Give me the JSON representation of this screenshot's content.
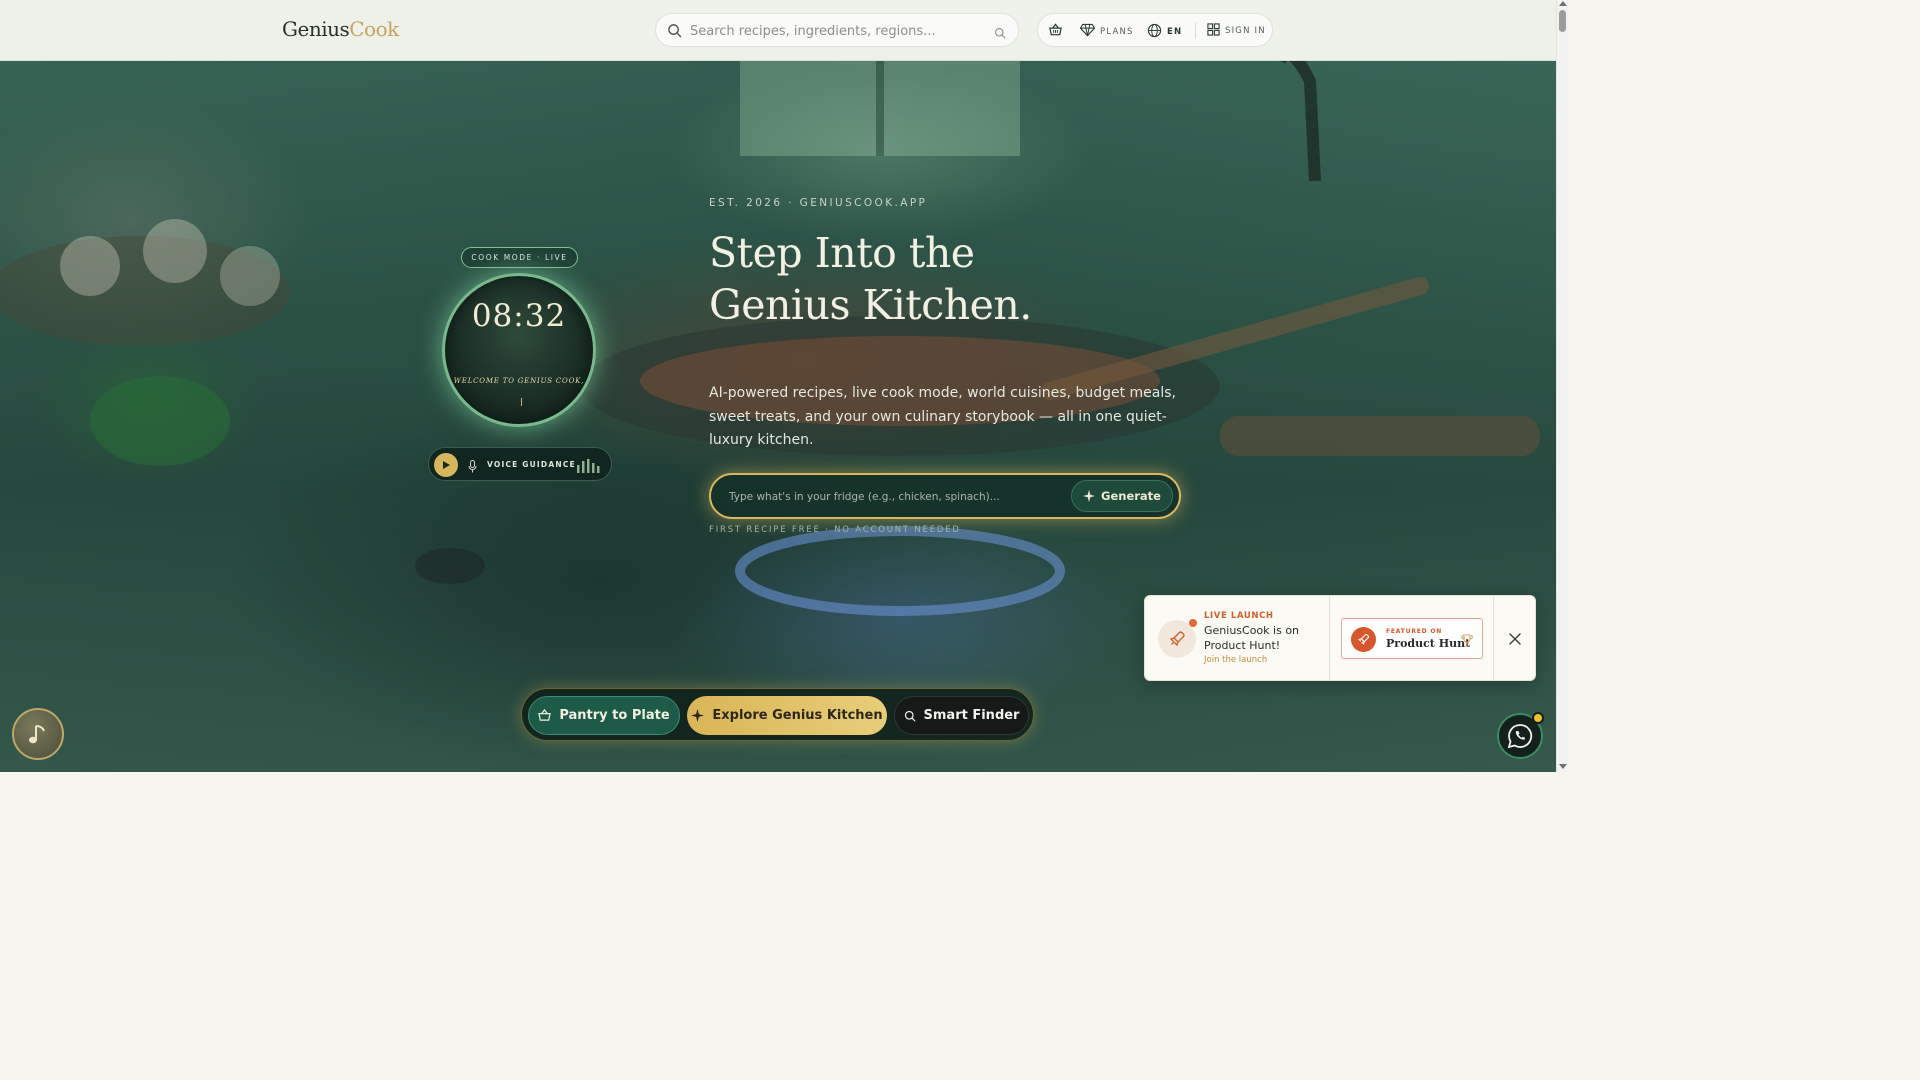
{
  "header": {
    "logo_main": "Genius",
    "logo_accent": "Cook",
    "search_placeholder": "Search recipes, ingredients, regions...",
    "nav": {
      "basket_icon": "basket-icon",
      "plans_label": "PLANS",
      "lang_label": "EN",
      "signin_label": "SIGN IN"
    }
  },
  "hero": {
    "eyebrow": "EST. 2026 · GENIUSCOOK.APP",
    "title_line1": "Step Into the",
    "title_line2": "Genius Kitchen.",
    "subtitle": "AI-powered recipes, live cook mode, world cuisines, budget meals, sweet treats, and your own culinary storybook — all in one quiet-luxury kitchen.",
    "fridge_placeholder": "Type what's in your fridge (e.g., chicken, spinach)...",
    "generate_label": "Generate",
    "fine_print": "FIRST RECIPE FREE · NO ACCOUNT NEEDED"
  },
  "cook_widget": {
    "badge": "COOK MODE · LIVE",
    "time": "08:32",
    "welcome": "WELCOME TO GENIUS COOK,",
    "voice_label": "VOICE GUIDANCE"
  },
  "actions": {
    "pantry_label": "Pantry to Plate",
    "explore_label": "Explore Genius Kitchen",
    "finder_label": "Smart Finder"
  },
  "toast": {
    "kicker": "LIVE LAUNCH",
    "message": "GeniusCook is on Product Hunt!",
    "join_label": "Join the launch",
    "badge_small": "FEATURED ON",
    "badge_big": "Product Hunt"
  },
  "colors": {
    "accent_gold": "#d9b656",
    "brand_green": "#1e5a48",
    "producthunt": "#d9552a",
    "whatsapp_ring": "#3c8a63"
  }
}
